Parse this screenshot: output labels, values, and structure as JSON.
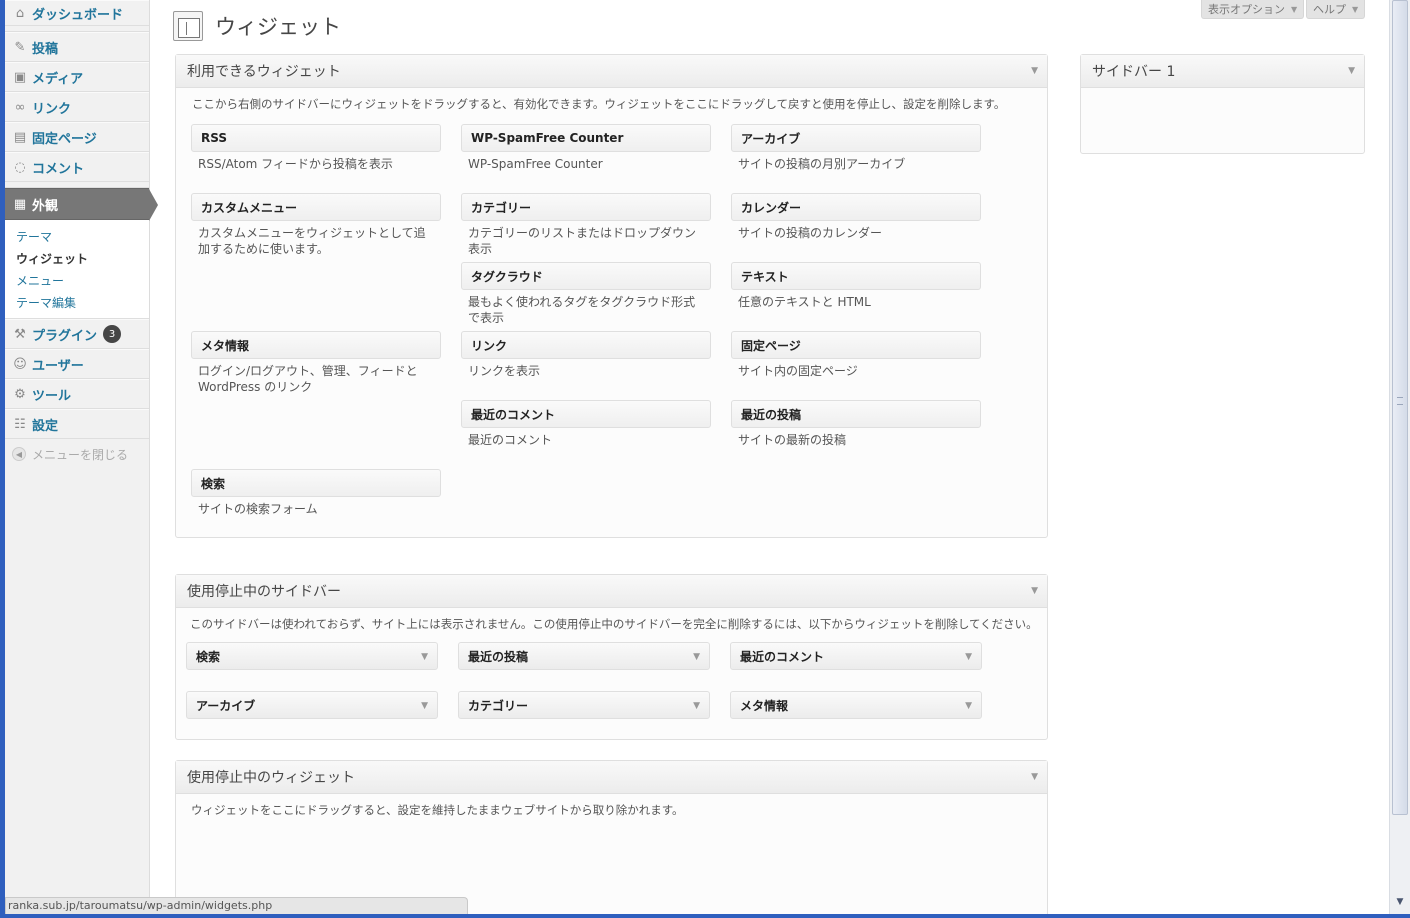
{
  "sidebar": {
    "items": [
      {
        "label": "ダッシュボード",
        "icon": "home-icon"
      },
      {
        "label": "投稿",
        "icon": "pin-icon"
      },
      {
        "label": "メディア",
        "icon": "media-icon"
      },
      {
        "label": "リンク",
        "icon": "link-icon"
      },
      {
        "label": "固定ページ",
        "icon": "page-icon"
      },
      {
        "label": "コメント",
        "icon": "comment-icon"
      },
      {
        "label": "外観",
        "icon": "appearance-icon"
      },
      {
        "label": "プラグイン",
        "icon": "plugin-icon",
        "badge": "3"
      },
      {
        "label": "ユーザー",
        "icon": "users-icon"
      },
      {
        "label": "ツール",
        "icon": "tools-icon"
      },
      {
        "label": "設定",
        "icon": "settings-icon"
      }
    ],
    "submenu": [
      "テーマ",
      "ウィジェット",
      "メニュー",
      "テーマ編集"
    ],
    "collapse_label": "メニューを閉じる"
  },
  "header": {
    "title": "ウィジェット",
    "screen_options": "表示オプション",
    "help": "ヘルプ"
  },
  "available": {
    "title": "利用できるウィジェット",
    "description": "ここから右側のサイドバーにウィジェットをドラッグすると、有効化できます。ウィジェットをここにドラッグして戻すと使用を停止し、設定を削除します。",
    "widgets": [
      {
        "title": "RSS",
        "desc": "RSS/Atom フィードから投稿を表示"
      },
      {
        "title": "WP-SpamFree Counter",
        "desc": "WP-SpamFree Counter"
      },
      {
        "title": "アーカイブ",
        "desc": "サイトの投稿の月別アーカイブ"
      },
      {
        "title": "カスタムメニュー",
        "desc": "カスタムメニューをウィジェットとして追加するために使います。"
      },
      {
        "title": "カテゴリー",
        "desc": "カテゴリーのリストまたはドロップダウン表示"
      },
      {
        "title": "カレンダー",
        "desc": "サイトの投稿のカレンダー"
      },
      {
        "title": "タグクラウド",
        "desc": "最もよく使われるタグをタグクラウド形式で表示"
      },
      {
        "title": "テキスト",
        "desc": "任意のテキストと HTML"
      },
      {
        "title": "メタ情報",
        "desc": "ログイン/ログアウト、管理、フィードと WordPress のリンク"
      },
      {
        "title": "リンク",
        "desc": "リンクを表示"
      },
      {
        "title": "固定ページ",
        "desc": "サイト内の固定ページ"
      },
      {
        "title": "最近のコメント",
        "desc": "最近のコメント"
      },
      {
        "title": "最近の投稿",
        "desc": "サイトの最新の投稿"
      },
      {
        "title": "検索",
        "desc": "サイトの検索フォーム"
      }
    ]
  },
  "inactive_sidebar": {
    "title": "使用停止中のサイドバー",
    "description": "このサイドバーは使われておらず、サイト上には表示されません。この使用停止中のサイドバーを完全に削除するには、以下からウィジェットを削除してください。",
    "widgets": [
      "検索",
      "最近の投稿",
      "最近のコメント",
      "アーカイブ",
      "カテゴリー",
      "メタ情報"
    ]
  },
  "inactive_widgets": {
    "title": "使用停止中のウィジェット",
    "description": "ウィジェットをここにドラッグすると、設定を維持したままウェブサイトから取り除かれます。"
  },
  "sidebar1": {
    "title": "サイドバー 1"
  },
  "status_url": "ranka.sub.jp/taroumatsu/wp-admin/widgets.php"
}
